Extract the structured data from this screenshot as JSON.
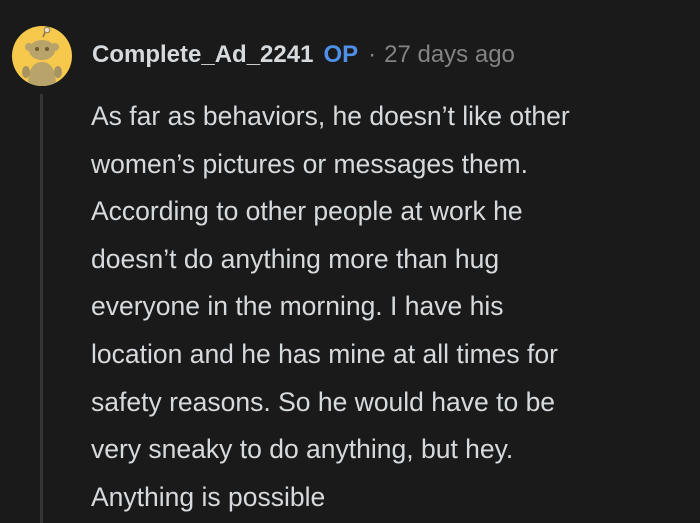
{
  "comment": {
    "author": "Complete_Ad_2241",
    "badge": "OP",
    "separator": "·",
    "time_ago": "27 days ago",
    "avatar_icon": "snoo-avatar-icon",
    "body_lines": [
      "As far as behaviors, he doesn’t like other",
      "women’s pictures or messages them.",
      "According to other people at work he",
      "doesn’t do anything more than hug",
      "everyone in the morning. I have his",
      "location and he has mine at all times for",
      "safety reasons. So he would have to be",
      "very sneaky to do anything, but hey.",
      "Anything is possible"
    ]
  },
  "colors": {
    "background": "#1a1a1b",
    "text": "#d7dadc",
    "muted": "#818384",
    "op_badge": "#4f8fe6",
    "avatar_bg": "#f6c84b",
    "thread_line": "#343536"
  }
}
